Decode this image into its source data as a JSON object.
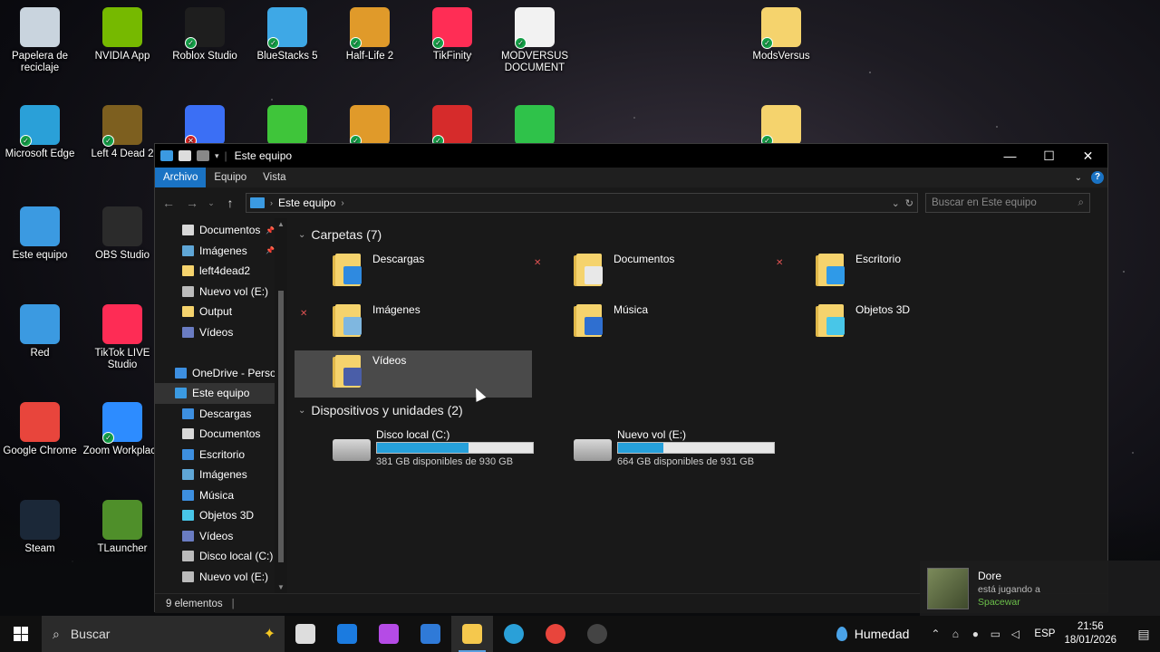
{
  "desktop": {
    "icons": [
      {
        "label": "Papelera de reciclaje",
        "color": "#c9d4de",
        "badge": "none"
      },
      {
        "label": "NVIDIA App",
        "color": "#76b900",
        "badge": "none"
      },
      {
        "label": "Roblox Studio",
        "color": "#1e1e1e",
        "badge": "check"
      },
      {
        "label": "BlueStacks 5",
        "color": "#3ea8e6",
        "badge": "check"
      },
      {
        "label": "Half-Life 2",
        "color": "#e09a2a",
        "badge": "check"
      },
      {
        "label": "TikFinity",
        "color": "#ff2d55",
        "badge": "check"
      },
      {
        "label": "MODVERSUS DOCUMENT",
        "color": "#f2f2f2",
        "badge": "check"
      },
      {
        "label": "ModsVersus",
        "color": "#f5d36d",
        "badge": "check"
      },
      {
        "label": "Microsoft Edge",
        "color": "#2aa0d8",
        "badge": "check"
      },
      {
        "label": "Left 4 Dead 2",
        "color": "#7d5f1f",
        "badge": "check"
      },
      {
        "label": "",
        "color": "#3b6ff5",
        "badge": "x"
      },
      {
        "label": "",
        "color": "#3fc53a",
        "badge": "none"
      },
      {
        "label": "",
        "color": "#e09a2a",
        "badge": "check"
      },
      {
        "label": "",
        "color": "#d62b2b",
        "badge": "check"
      },
      {
        "label": "",
        "color": "#2fc24a",
        "badge": "none"
      },
      {
        "label": "",
        "color": "#f5d36d",
        "badge": "check"
      },
      {
        "label": "Este equipo",
        "color": "#3b9ae1",
        "badge": "none"
      },
      {
        "label": "OBS Studio",
        "color": "#2b2b2b",
        "badge": "none"
      },
      {
        "label": "Red",
        "color": "#3b9ae1",
        "badge": "none"
      },
      {
        "label": "TikTok LIVE Studio",
        "color": "#fe2c55",
        "badge": "none"
      },
      {
        "label": "Google Chrome",
        "color": "#e8453c",
        "badge": "none"
      },
      {
        "label": "Zoom Workplace",
        "color": "#2d8cff",
        "badge": "check"
      },
      {
        "label": "Steam",
        "color": "#1b2838",
        "badge": "none"
      },
      {
        "label": "TLauncher",
        "color": "#4f8f2a",
        "badge": "none"
      }
    ]
  },
  "window": {
    "title": "Este equipo",
    "controls": {
      "minimize": "—",
      "maximize": "☐",
      "close": "✕"
    },
    "ribbon_tabs": [
      "Archivo",
      "Equipo",
      "Vista"
    ],
    "address": {
      "location": "Este equipo"
    },
    "search": {
      "placeholder": "Buscar en Este equipo"
    },
    "sidebar": [
      {
        "label": "Documentos",
        "pinned": true,
        "color": "#d8d8d8"
      },
      {
        "label": "Imágenes",
        "pinned": true,
        "color": "#5fa6d6"
      },
      {
        "label": "left4dead2",
        "pinned": false,
        "color": "#f5d36d"
      },
      {
        "label": "Nuevo vol (E:)",
        "pinned": false,
        "color": "#bbbbbb"
      },
      {
        "label": "Output",
        "pinned": false,
        "color": "#f5d36d"
      },
      {
        "label": "Vídeos",
        "pinned": false,
        "color": "#6a7cc2"
      },
      {
        "label": "",
        "pinned": false,
        "color": "transparent"
      },
      {
        "label": "OneDrive - Persor",
        "pinned": false,
        "color": "#3d8fe0"
      },
      {
        "label": "Este equipo",
        "pinned": false,
        "color": "#3b9ae1"
      },
      {
        "label": "Descargas",
        "pinned": false,
        "color": "#3d8fe0"
      },
      {
        "label": "Documentos",
        "pinned": false,
        "color": "#d8d8d8"
      },
      {
        "label": "Escritorio",
        "pinned": false,
        "color": "#3d8fe0"
      },
      {
        "label": "Imágenes",
        "pinned": false,
        "color": "#5fa6d6"
      },
      {
        "label": "Música",
        "pinned": false,
        "color": "#3d8fe0"
      },
      {
        "label": "Objetos 3D",
        "pinned": false,
        "color": "#48c6e8"
      },
      {
        "label": "Vídeos",
        "pinned": false,
        "color": "#6a7cc2"
      },
      {
        "label": "Disco local (C:)",
        "pinned": false,
        "color": "#bbbbbb"
      },
      {
        "label": "Nuevo vol (E:)",
        "pinned": false,
        "color": "#bbbbbb"
      }
    ],
    "folders_header": "Carpetas (7)",
    "folders": [
      {
        "label": "Descargas",
        "emblem": "#2f8ae0",
        "error": false
      },
      {
        "label": "Documentos",
        "emblem": "#e8e8e8",
        "error": true
      },
      {
        "label": "Escritorio",
        "emblem": "#2f9ae8",
        "error": true
      },
      {
        "label": "Imágenes",
        "emblem": "#7fb7e0",
        "error": true
      },
      {
        "label": "Música",
        "emblem": "#2f6fd0",
        "error": false
      },
      {
        "label": "Objetos 3D",
        "emblem": "#48c6e8",
        "error": false
      },
      {
        "label": "Vídeos",
        "emblem": "#4a5ea8",
        "error": false
      }
    ],
    "devices_header": "Dispositivos y unidades (2)",
    "drives": [
      {
        "name": "Disco local (C:)",
        "free": "381 GB disponibles de 930 GB",
        "used_fraction": 0.59
      },
      {
        "name": "Nuevo vol (E:)",
        "free": "664 GB disponibles de 931 GB",
        "used_fraction": 0.29
      }
    ],
    "status": "9 elementos"
  },
  "notification": {
    "name": "Dore",
    "line": "está jugando a",
    "game": "Spacewar"
  },
  "taskbar": {
    "search_label": "Buscar",
    "apps": [
      {
        "name": "task-view",
        "color": "#dddddd",
        "active": false
      },
      {
        "name": "outlook",
        "color": "#1b7be0",
        "active": false
      },
      {
        "name": "copilot",
        "color": "#b54be6",
        "active": false
      },
      {
        "name": "store",
        "color": "#2f7ad8",
        "active": false
      },
      {
        "name": "file-explorer",
        "color": "#f5c84d",
        "active": true
      },
      {
        "name": "edge",
        "color": "#2aa0d8",
        "active": false
      },
      {
        "name": "chrome",
        "color": "#e8453c",
        "active": false
      },
      {
        "name": "obs",
        "color": "#444444",
        "active": false
      }
    ],
    "weather": "Humedad",
    "language": "ESP",
    "time": "21:56",
    "date": "18/01/2026"
  }
}
